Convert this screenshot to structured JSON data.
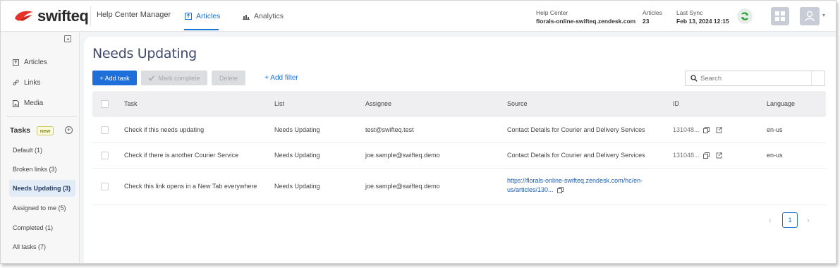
{
  "header": {
    "logo_text": "swifteq",
    "app_title": "Help Center Manager",
    "tabs": [
      {
        "label": "Articles",
        "icon": "articles-icon",
        "active": true
      },
      {
        "label": "Analytics",
        "icon": "bar-chart-icon",
        "active": false
      }
    ],
    "help_center": {
      "label": "Help Center",
      "value": "florals-online-swifteq.zendesk.com"
    },
    "articles": {
      "label": "Articles",
      "value": "23"
    },
    "last_sync": {
      "label": "Last Sync",
      "value": "Feb 13, 2024 12:15"
    },
    "colors": {
      "accent": "#1e72d6",
      "sync_green": "#2aa035",
      "logo_red": "#e5332a"
    }
  },
  "sidebar": {
    "nav": [
      {
        "label": "Articles",
        "icon": "article-icon"
      },
      {
        "label": "Links",
        "icon": "link-icon"
      },
      {
        "label": "Media",
        "icon": "media-icon"
      }
    ],
    "tasks_label": "Tasks",
    "new_badge": "new",
    "task_lists": [
      {
        "label": "Default (1)"
      },
      {
        "label": "Broken links (3)"
      },
      {
        "label": "Needs Updating (3)",
        "active": true
      },
      {
        "label": "Assigned to me (5)"
      },
      {
        "label": "Completed (1)"
      },
      {
        "label": "All tasks (7)"
      }
    ]
  },
  "main": {
    "title": "Needs Updating",
    "toolbar": {
      "add_task": "+ Add task",
      "mark_complete": "Mark complete",
      "delete": "Delete",
      "add_filter": "+ Add filter"
    },
    "search": {
      "placeholder": "Search",
      "value": ""
    },
    "columns": [
      "Task",
      "List",
      "Assignee",
      "Source",
      "ID",
      "Language"
    ],
    "rows": [
      {
        "task": "Check if this needs updating",
        "list": "Needs Updating",
        "assignee": "test@swifteq.test",
        "source": "Contact Details for Courier and Delivery Services",
        "source_line2": "",
        "id": "131048...",
        "language": "en-us"
      },
      {
        "task": "Check if there is another Courier Service",
        "list": "Needs Updating",
        "assignee": "joe.sample@swifteq.demo",
        "source": "Contact Details for Courier and Delivery Services",
        "source_line2": "",
        "id": "131048...",
        "language": "en-us"
      },
      {
        "task": "Check this link opens in a New Tab everywhere",
        "list": "Needs Updating",
        "assignee": "joe.sample@swifteq.demo",
        "source": "https://florals-online-swifteq.zendesk.com/hc/en-",
        "source_line2": "us/articles/130...",
        "id": "",
        "language": ""
      }
    ],
    "pagination": {
      "current": "1",
      "prev": "‹",
      "next": "›"
    }
  }
}
